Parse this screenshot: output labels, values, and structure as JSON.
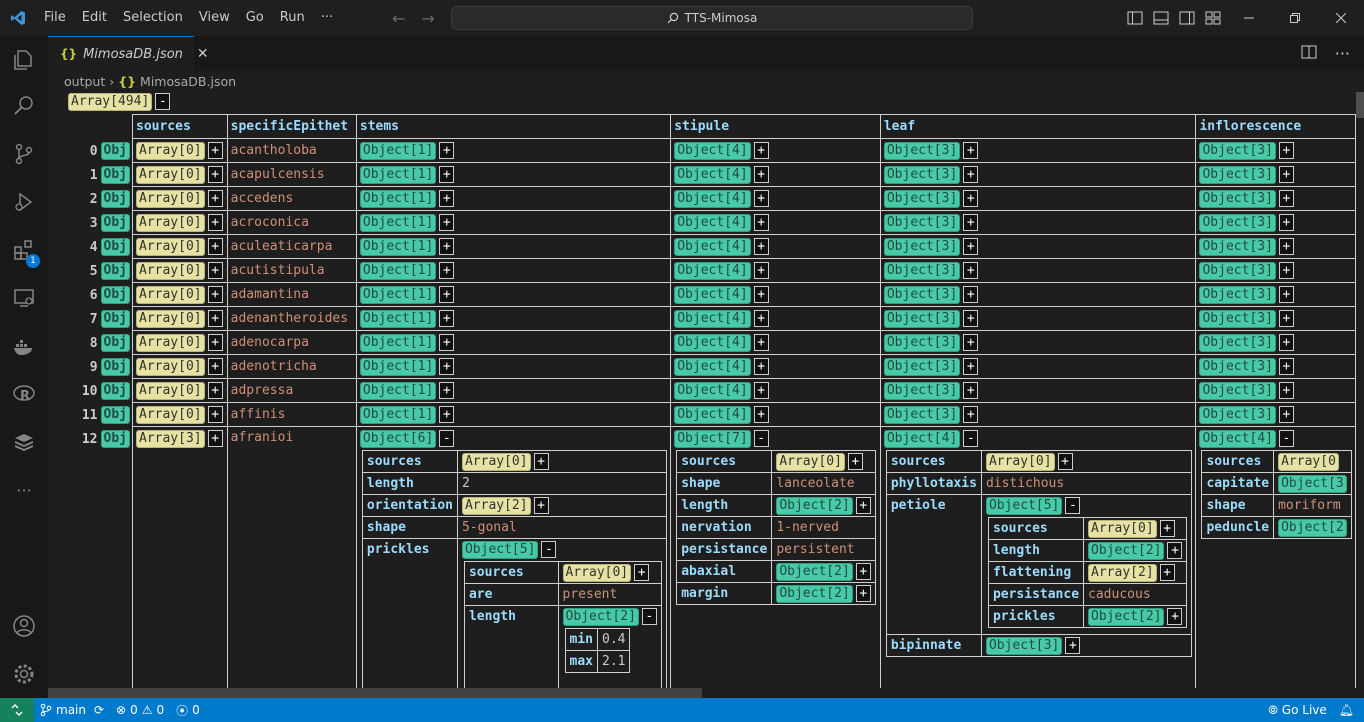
{
  "window": {
    "title": "TTS-Mimosa"
  },
  "menu": [
    "File",
    "Edit",
    "Selection",
    "View",
    "Go",
    "Run",
    "···"
  ],
  "tab": {
    "filename": "MimosaDB.json",
    "braces": "{}"
  },
  "breadcrumb": {
    "folder": "output",
    "file": "MimosaDB.json"
  },
  "activity": {
    "extensions_badge": "1"
  },
  "root": {
    "label": "Array[494]",
    "toggle": "-"
  },
  "columns": [
    "sources",
    "specificEpithet",
    "stems",
    "stipule",
    "leaf",
    "inflorescence"
  ],
  "rows": [
    {
      "idx": "0",
      "obj": "Obj",
      "sources": "Array[0]",
      "epithet": "acantholoba",
      "stems": "Object[1]",
      "stipule": "Object[4]",
      "leaf": "Object[3]",
      "inflorescence": "Object[3]"
    },
    {
      "idx": "1",
      "obj": "Obj",
      "sources": "Array[0]",
      "epithet": "acapulcensis",
      "stems": "Object[1]",
      "stipule": "Object[4]",
      "leaf": "Object[3]",
      "inflorescence": "Object[3]"
    },
    {
      "idx": "2",
      "obj": "Obj",
      "sources": "Array[0]",
      "epithet": "accedens",
      "stems": "Object[1]",
      "stipule": "Object[4]",
      "leaf": "Object[3]",
      "inflorescence": "Object[3]"
    },
    {
      "idx": "3",
      "obj": "Obj",
      "sources": "Array[0]",
      "epithet": "acroconica",
      "stems": "Object[1]",
      "stipule": "Object[4]",
      "leaf": "Object[3]",
      "inflorescence": "Object[3]"
    },
    {
      "idx": "4",
      "obj": "Obj",
      "sources": "Array[0]",
      "epithet": "aculeaticarpa",
      "stems": "Object[1]",
      "stipule": "Object[4]",
      "leaf": "Object[3]",
      "inflorescence": "Object[3]"
    },
    {
      "idx": "5",
      "obj": "Obj",
      "sources": "Array[0]",
      "epithet": "acutistipula",
      "stems": "Object[1]",
      "stipule": "Object[4]",
      "leaf": "Object[3]",
      "inflorescence": "Object[3]"
    },
    {
      "idx": "6",
      "obj": "Obj",
      "sources": "Array[0]",
      "epithet": "adamantina",
      "stems": "Object[1]",
      "stipule": "Object[4]",
      "leaf": "Object[3]",
      "inflorescence": "Object[3]"
    },
    {
      "idx": "7",
      "obj": "Obj",
      "sources": "Array[0]",
      "epithet": "adenantheroides",
      "stems": "Object[1]",
      "stipule": "Object[4]",
      "leaf": "Object[3]",
      "inflorescence": "Object[3]"
    },
    {
      "idx": "8",
      "obj": "Obj",
      "sources": "Array[0]",
      "epithet": "adenocarpa",
      "stems": "Object[1]",
      "stipule": "Object[4]",
      "leaf": "Object[3]",
      "inflorescence": "Object[3]"
    },
    {
      "idx": "9",
      "obj": "Obj",
      "sources": "Array[0]",
      "epithet": "adenotricha",
      "stems": "Object[1]",
      "stipule": "Object[4]",
      "leaf": "Object[3]",
      "inflorescence": "Object[3]"
    },
    {
      "idx": "10",
      "obj": "Obj",
      "sources": "Array[0]",
      "epithet": "adpressa",
      "stems": "Object[1]",
      "stipule": "Object[4]",
      "leaf": "Object[3]",
      "inflorescence": "Object[3]"
    },
    {
      "idx": "11",
      "obj": "Obj",
      "sources": "Array[0]",
      "epithet": "affinis",
      "stems": "Object[1]",
      "stipule": "Object[4]",
      "leaf": "Object[3]",
      "inflorescence": "Object[3]"
    }
  ],
  "expanded": {
    "idx": "12",
    "obj": "Obj",
    "sources": "Array[3]",
    "epithet": "afranioi",
    "stems": {
      "label": "Object[6]",
      "sources": "Array[0]",
      "length": "2",
      "orientation": "Array[2]",
      "shape": "5-gonal",
      "prickles": {
        "label": "Object[5]",
        "sources": "Array[0]",
        "are": "present",
        "length": {
          "label": "Object[2]",
          "min": "0.4",
          "max": "2.1"
        }
      }
    },
    "stipule": {
      "label": "Object[7]",
      "sources": "Array[0]",
      "shape": "lanceolate",
      "length": "Object[2]",
      "nervation": "1-nerved",
      "persistance": "persistent",
      "abaxial": "Object[2]",
      "margin": "Object[2]"
    },
    "leaf": {
      "label": "Object[4]",
      "sources": "Array[0]",
      "phyllotaxis": "distichous",
      "petiole": {
        "label": "Object[5]",
        "sources": "Array[0]",
        "length": "Object[2]",
        "flattening": "Array[2]",
        "persistance": "caducous",
        "prickles": "Object[2]"
      },
      "bipinnate": "Object[3]"
    },
    "inflorescence": {
      "label": "Object[4]",
      "sources": "Array[0",
      "capitate": "Object[3",
      "shape": "moriform",
      "peduncle": "Object[2"
    }
  },
  "keys": {
    "sources": "sources",
    "length": "length",
    "orientation": "orientation",
    "shape": "shape",
    "prickles": "prickles",
    "are": "are",
    "min": "min",
    "max": "max",
    "nervation": "nervation",
    "persistance": "persistance",
    "abaxial": "abaxial",
    "margin": "margin",
    "phyllotaxis": "phyllotaxis",
    "petiole": "petiole",
    "flattening": "flattening",
    "bipinnate": "bipinnate",
    "capitate": "capitate",
    "peduncle": "peduncle"
  },
  "statusbar": {
    "branch": "main",
    "errors": "0",
    "warnings": "0",
    "ports": "0",
    "golive": "Go Live"
  },
  "colors": {
    "statusbar": "#007acc",
    "array_chip": "#e6e2a3",
    "object_chip": "#48c9a8",
    "key": "#9cdcfe",
    "string": "#ce9178"
  }
}
